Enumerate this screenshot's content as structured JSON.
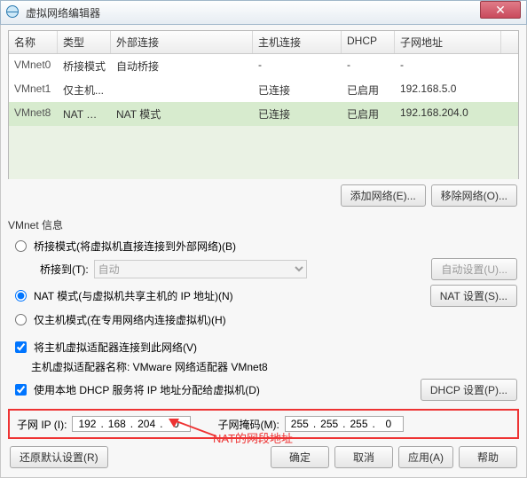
{
  "window": {
    "title": "虚拟网络编辑器"
  },
  "grid": {
    "headers": {
      "name": "名称",
      "type": "类型",
      "ext": "外部连接",
      "host": "主机连接",
      "dhcp": "DHCP",
      "subnet": "子网地址"
    },
    "rows": [
      {
        "name": "VMnet0",
        "type": "桥接模式",
        "ext": "自动桥接",
        "host": "-",
        "dhcp": "-",
        "subnet": "-"
      },
      {
        "name": "VMnet1",
        "type": "仅主机...",
        "ext": "",
        "host": "已连接",
        "dhcp": "已启用",
        "subnet": "192.168.5.0"
      },
      {
        "name": "VMnet8",
        "type": "NAT 模式",
        "ext": "NAT 模式",
        "host": "已连接",
        "dhcp": "已启用",
        "subnet": "192.168.204.0"
      }
    ]
  },
  "buttons": {
    "add_net": "添加网络(E)...",
    "remove_net": "移除网络(O)...",
    "auto_set": "自动设置(U)...",
    "nat_set": "NAT 设置(S)...",
    "dhcp_set": "DHCP 设置(P)...",
    "restore": "还原默认设置(R)",
    "ok": "确定",
    "cancel": "取消",
    "apply": "应用(A)",
    "help": "帮助"
  },
  "vmnet": {
    "title": "VMnet 信息",
    "bridge": "桥接模式(将虚拟机直接连接到外部网络)(B)",
    "bridge_to_label": "桥接到(T):",
    "bridge_to_val": "自动",
    "nat": "NAT 模式(与虚拟机共享主机的 IP 地址)(N)",
    "hostonly": "仅主机模式(在专用网络内连接虚拟机)(H)",
    "connect_host": "将主机虚拟适配器连接到此网络(V)",
    "adapter_label": "主机虚拟适配器名称: VMware 网络适配器 VMnet8",
    "use_dhcp": "使用本地 DHCP 服务将 IP 地址分配给虚拟机(D)"
  },
  "ip": {
    "subnet_label": "子网 IP (I):",
    "mask_label": "子网掩码(M):",
    "subnet": [
      "192",
      "168",
      "204",
      "0"
    ],
    "mask": [
      "255",
      "255",
      "255",
      "0"
    ]
  },
  "annotation": "NAT的网段地址"
}
